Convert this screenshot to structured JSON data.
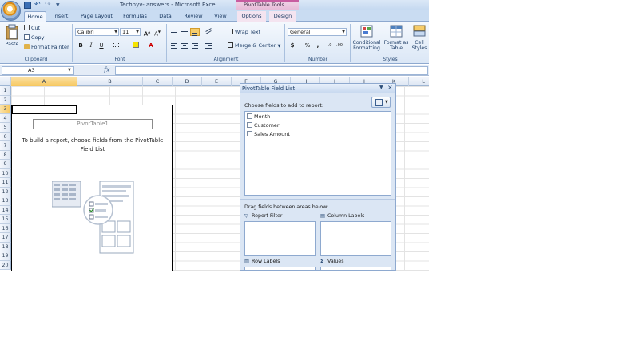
{
  "window": {
    "title": "Technyv- answers - Microsoft Excel",
    "context_tools": "PivotTable Tools"
  },
  "tabs": [
    "Home",
    "Insert",
    "Page Layout",
    "Formulas",
    "Data",
    "Review",
    "View",
    "Options",
    "Design"
  ],
  "active_tab": "Home",
  "ribbon": {
    "clipboard": {
      "paste": "Paste",
      "cut": "Cut",
      "copy": "Copy",
      "format_painter": "Format Painter",
      "label": "Clipboard"
    },
    "font": {
      "name": "Calibri",
      "size": "11",
      "bold": "B",
      "italic": "I",
      "underline": "U",
      "label": "Font"
    },
    "alignment": {
      "wrap_text": "Wrap Text",
      "merge_center": "Merge & Center",
      "label": "Alignment"
    },
    "number": {
      "format": "General",
      "currency": "$",
      "percent": "%",
      "comma": ",",
      "label": "Number"
    },
    "styles": {
      "conditional": "Conditional Formatting",
      "format_table": "Format as Table",
      "cell_styles": "Cell Styles",
      "label": "Styles"
    }
  },
  "formula_bar": {
    "name_box": "A3",
    "fx": "fx",
    "value": ""
  },
  "grid": {
    "columns": [
      "A",
      "B",
      "C",
      "D",
      "E",
      "F",
      "G",
      "H",
      "I",
      "J",
      "K",
      "L"
    ],
    "selected_column": "A",
    "rows": [
      "1",
      "2",
      "3",
      "4",
      "5",
      "6",
      "7",
      "8",
      "9",
      "10",
      "11",
      "12",
      "13",
      "14",
      "15",
      "16",
      "17",
      "18",
      "19",
      "20"
    ],
    "selected_row": "3"
  },
  "pivot_placeholder": {
    "name": "PivotTable1",
    "help_text": "To build a report, choose fields from the PivotTable Field List"
  },
  "field_list": {
    "title": "PivotTable Field List",
    "choose_label": "Choose fields to add to report:",
    "fields": [
      "Month",
      "Customer",
      "Sales Amount"
    ],
    "drag_label": "Drag fields between areas below:",
    "areas": {
      "report_filter": "Report Filter",
      "column_labels": "Column Labels",
      "row_labels": "Row Labels",
      "values": "Values"
    }
  }
}
